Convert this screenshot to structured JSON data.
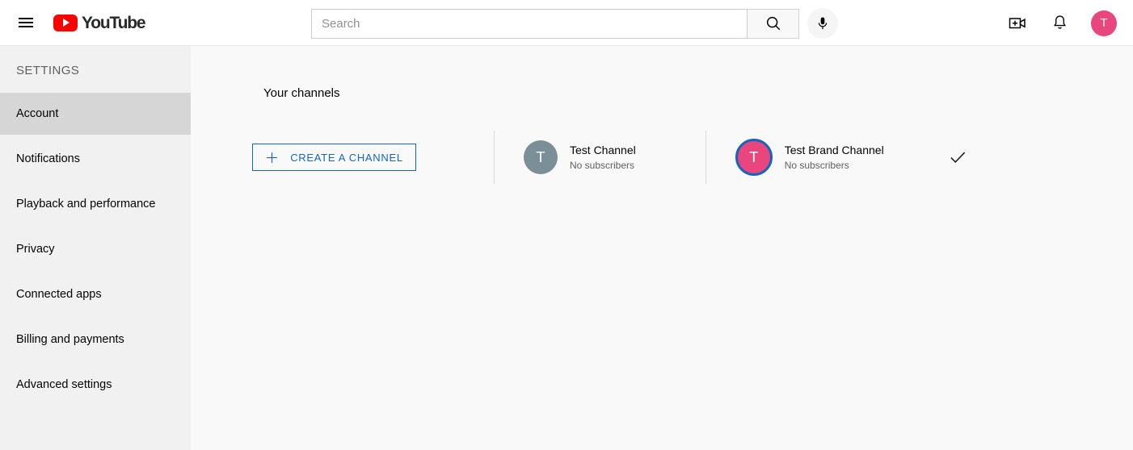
{
  "header": {
    "menu_label": "Guide",
    "logo_text": "YouTube",
    "search": {
      "value": "",
      "placeholder": "Search",
      "submit_label": "Search",
      "mic_label": "Search with your voice"
    },
    "create_label": "Create",
    "notifications_label": "Notifications",
    "avatar_initial": "T"
  },
  "sidebar": {
    "title": "SETTINGS",
    "items": [
      {
        "label": "Account",
        "active": true
      },
      {
        "label": "Notifications",
        "active": false
      },
      {
        "label": "Playback and performance",
        "active": false
      },
      {
        "label": "Privacy",
        "active": false
      },
      {
        "label": "Connected apps",
        "active": false
      },
      {
        "label": "Billing and payments",
        "active": false
      },
      {
        "label": "Advanced settings",
        "active": false
      }
    ]
  },
  "main": {
    "section_title": "Your channels",
    "create_channel_label": "CREATE A CHANNEL",
    "channels": [
      {
        "name": "Test Channel",
        "subscribers": "No subscribers",
        "avatar_initial": "T",
        "avatar_color": "#7b8f99",
        "selected": false
      },
      {
        "name": "Test Brand Channel",
        "subscribers": "No subscribers",
        "avatar_initial": "T",
        "avatar_color": "#e8467c",
        "selected": true
      }
    ]
  },
  "colors": {
    "brand_red": "#ff0000",
    "accent_blue": "#1565c0",
    "sidebar_bg": "#f1f1f1",
    "sidebar_active_bg": "#d6d6d6",
    "main_bg": "#f9f9f9",
    "avatar_pink": "#e8467c",
    "avatar_grey": "#7b8f99"
  }
}
